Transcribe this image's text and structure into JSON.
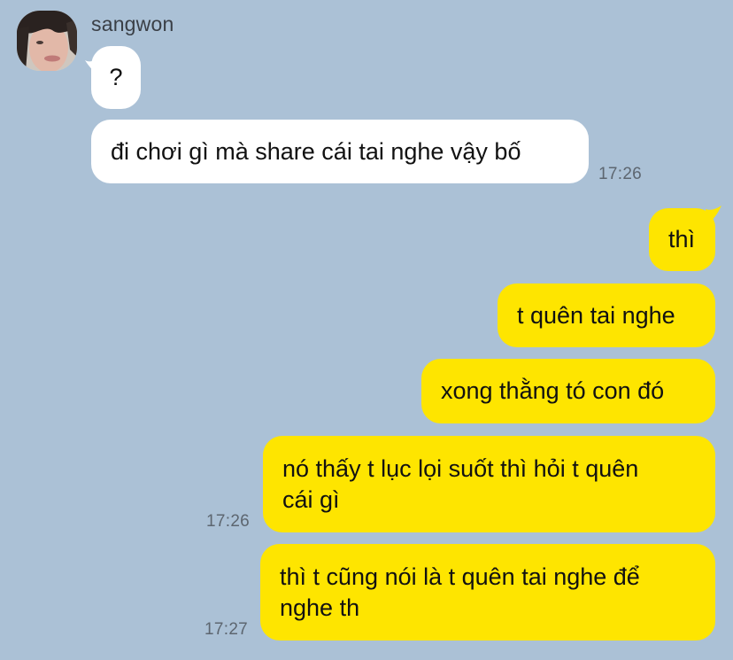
{
  "contact": {
    "name": "sangwon"
  },
  "colors": {
    "background": "#abc1d6",
    "incoming_bubble": "#ffffff",
    "outgoing_bubble": "#fee500"
  },
  "messages": [
    {
      "direction": "incoming",
      "text": "?",
      "time": ""
    },
    {
      "direction": "incoming",
      "text": "đi chơi gì mà share cái tai nghe vậy bố",
      "time": "17:26"
    },
    {
      "direction": "outgoing",
      "text": "thì",
      "time": ""
    },
    {
      "direction": "outgoing",
      "text": "t quên tai nghe",
      "time": ""
    },
    {
      "direction": "outgoing",
      "text": "xong thằng tó con đó",
      "time": ""
    },
    {
      "direction": "outgoing",
      "text": "nó thấy t lục lọi suốt thì hỏi t quên\ncái gì",
      "time": "17:26"
    },
    {
      "direction": "outgoing",
      "text": "thì t cũng nói là t quên tai nghe để\nnghe th",
      "time": "17:27"
    }
  ]
}
